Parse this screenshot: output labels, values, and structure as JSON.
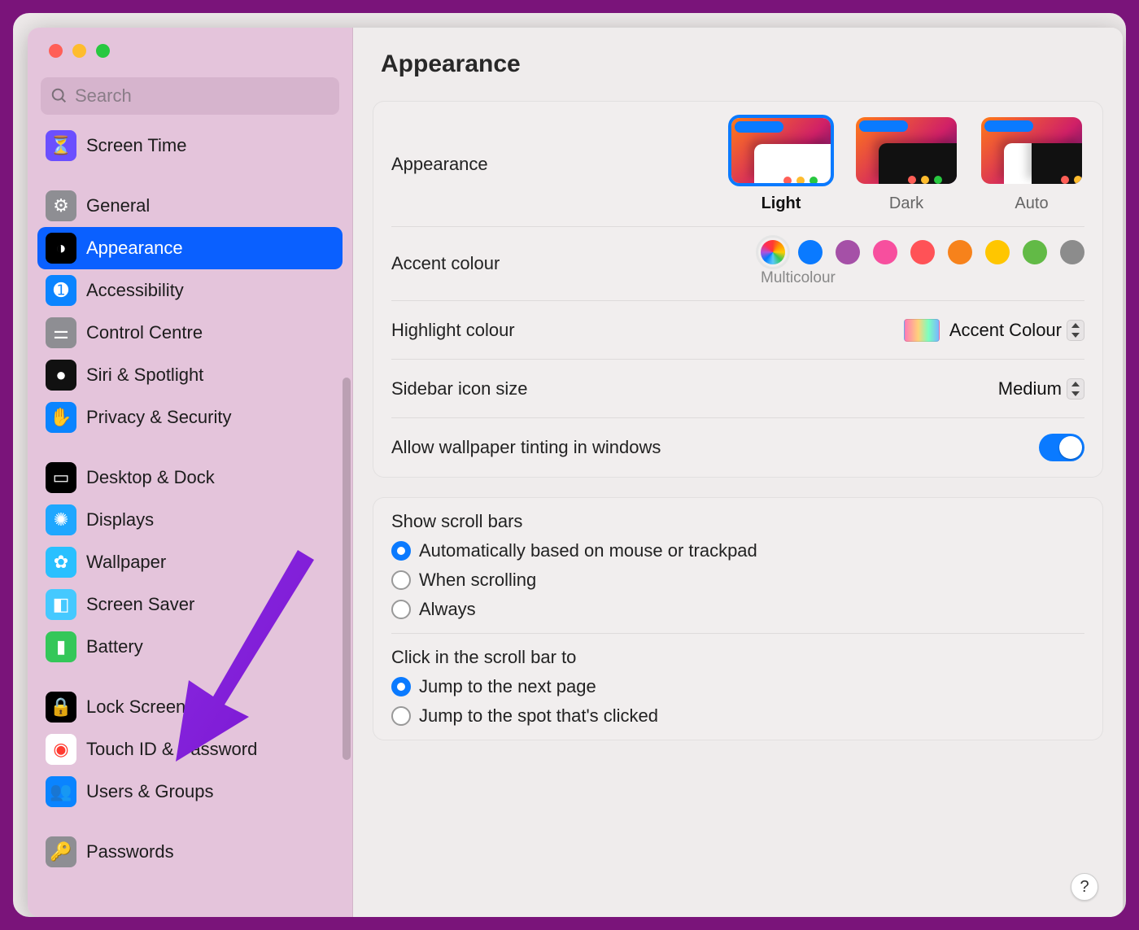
{
  "search": {
    "placeholder": "Search"
  },
  "sidebar": {
    "groups": [
      [
        {
          "label": "Screen Time",
          "iconBg": "#6b4fff",
          "glyph": "⏳"
        }
      ],
      [
        {
          "label": "General",
          "iconBg": "#8e8e93",
          "glyph": "⚙"
        },
        {
          "label": "Appearance",
          "iconBg": "#000000",
          "glyph": "◑",
          "selected": true
        },
        {
          "label": "Accessibility",
          "iconBg": "#0a84ff",
          "glyph": "➊"
        },
        {
          "label": "Control Centre",
          "iconBg": "#8e8e93",
          "glyph": "⚌"
        },
        {
          "label": "Siri & Spotlight",
          "iconBg": "#111111",
          "glyph": "●"
        },
        {
          "label": "Privacy & Security",
          "iconBg": "#0a84ff",
          "glyph": "✋"
        }
      ],
      [
        {
          "label": "Desktop & Dock",
          "iconBg": "#000000",
          "glyph": "▭"
        },
        {
          "label": "Displays",
          "iconBg": "#1fa7ff",
          "glyph": "✺"
        },
        {
          "label": "Wallpaper",
          "iconBg": "#29c0ff",
          "glyph": "✿"
        },
        {
          "label": "Screen Saver",
          "iconBg": "#45c9ff",
          "glyph": "◧"
        },
        {
          "label": "Battery",
          "iconBg": "#34c759",
          "glyph": "▮"
        }
      ],
      [
        {
          "label": "Lock Screen",
          "iconBg": "#000000",
          "glyph": "🔒"
        },
        {
          "label": "Touch ID & Password",
          "iconBg": "#ffffff",
          "glyph": "◉",
          "glyphColor": "#ff3b30"
        },
        {
          "label": "Users & Groups",
          "iconBg": "#0a84ff",
          "glyph": "👥"
        }
      ],
      [
        {
          "label": "Passwords",
          "iconBg": "#8e8e93",
          "glyph": "🔑"
        }
      ]
    ]
  },
  "page": {
    "title": "Appearance"
  },
  "appearanceRow": {
    "label": "Appearance",
    "options": [
      {
        "label": "Light",
        "selected": true
      },
      {
        "label": "Dark"
      },
      {
        "label": "Auto"
      }
    ]
  },
  "accentRow": {
    "label": "Accent colour",
    "caption": "Multicolour",
    "colors": [
      "multicolour",
      "#0a7aff",
      "#a550a7",
      "#f74f9e",
      "#ff5257",
      "#f7821b",
      "#ffc600",
      "#62ba46",
      "#8c8c8c"
    ],
    "selectedIndex": 0
  },
  "highlightRow": {
    "label": "Highlight colour",
    "value": "Accent Colour"
  },
  "sidebarIconRow": {
    "label": "Sidebar icon size",
    "value": "Medium"
  },
  "tintRow": {
    "label": "Allow wallpaper tinting in windows",
    "on": true
  },
  "scrollBars": {
    "title": "Show scroll bars",
    "options": [
      "Automatically based on mouse or trackpad",
      "When scrolling",
      "Always"
    ],
    "selectedIndex": 0
  },
  "scrollClick": {
    "title": "Click in the scroll bar to",
    "options": [
      "Jump to the next page",
      "Jump to the spot that's clicked"
    ],
    "selectedIndex": 0
  },
  "helpGlyph": "?"
}
